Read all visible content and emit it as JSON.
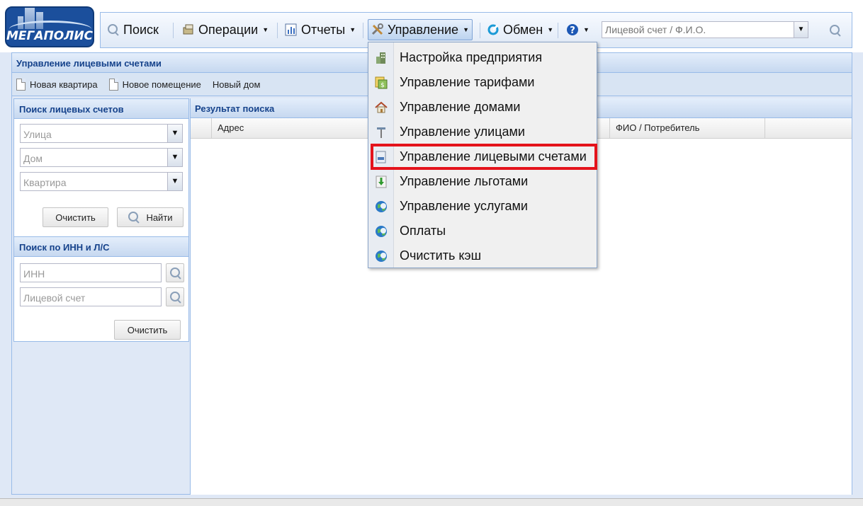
{
  "app": {
    "logo_text": "МЕГАПОЛИС"
  },
  "toolbar": {
    "search_label": "Поиск",
    "operations_label": "Операции",
    "reports_label": "Отчеты",
    "management_label": "Управление",
    "exchange_label": "Обмен",
    "account_search": {
      "placeholder": "Лицевой счет / Ф.И.О.",
      "value": ""
    }
  },
  "page": {
    "title": "Управление лицевыми счетами",
    "actions": [
      "Новая квартира",
      "Новое помещение",
      "Новый дом"
    ]
  },
  "account_search_panel": {
    "title": "Поиск лицевых счетов",
    "street_placeholder": "Улица",
    "house_placeholder": "Дом",
    "apartment_placeholder": "Квартира",
    "clear_label": "Очистить",
    "find_label": "Найти"
  },
  "inn_search_panel": {
    "title": "Поиск по ИНН и Л/С",
    "inn_placeholder": "ИНН",
    "account_placeholder": "Лицевой счет",
    "clear_label": "Очистить"
  },
  "results": {
    "title": "Результат поиска",
    "columns": [
      "Адрес",
      "ФИО / Потребитель"
    ]
  },
  "management_menu": {
    "items": [
      {
        "label": "Настройка предприятия",
        "icon": "enterprise-settings-icon"
      },
      {
        "label": "Управление тарифами",
        "icon": "tariffs-icon"
      },
      {
        "label": "Управление домами",
        "icon": "house-icon"
      },
      {
        "label": "Управление улицами",
        "icon": "street-sign-icon"
      },
      {
        "label": "Управление лицевыми счетами",
        "icon": "account-card-icon",
        "highlighted": true
      },
      {
        "label": "Управление льготами",
        "icon": "benefits-download-icon"
      },
      {
        "label": "Управление услугами",
        "icon": "globe-icon"
      },
      {
        "label": "Оплаты",
        "icon": "globe-icon"
      },
      {
        "label": "Очистить кэш",
        "icon": "globe-icon"
      }
    ],
    "highlight_color": "#e4131b"
  }
}
